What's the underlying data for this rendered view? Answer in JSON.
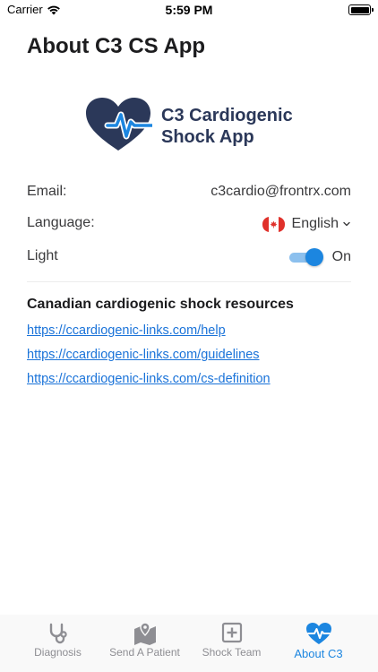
{
  "status_bar": {
    "carrier": "Carrier",
    "time": "5:59 PM",
    "icons": [
      "wifi-icon",
      "battery-icon"
    ]
  },
  "page": {
    "title": "About C3 CS App"
  },
  "logo": {
    "line1": "C3 Cardiogenic",
    "line2": "Shock App",
    "colors": {
      "heart": "#2b3859",
      "pulse": "#1c86e0"
    }
  },
  "settings": {
    "email": {
      "label": "Email:",
      "value": "c3cardio@frontrx.com"
    },
    "language": {
      "label": "Language:",
      "value": "English",
      "flag": "canada-flag-icon"
    },
    "light": {
      "label": "Light",
      "state": "On",
      "enabled": true
    }
  },
  "resources": {
    "heading": "Canadian cardiogenic shock resources",
    "links": [
      "https://ccardiogenic-links.com/help",
      "https://ccardiogenic-links.com/guidelines",
      "https://ccardiogenic-links.com/cs-definition"
    ]
  },
  "tab_bar": {
    "tabs": [
      {
        "label": "Diagnosis",
        "icon": "stethoscope-icon",
        "active": false
      },
      {
        "label": "Send A Patient",
        "icon": "map-pin-icon",
        "active": false
      },
      {
        "label": "Shock Team",
        "icon": "plus-square-icon",
        "active": false
      },
      {
        "label": "About C3",
        "icon": "heart-pulse-icon",
        "active": true
      }
    ]
  },
  "colors": {
    "accent": "#1c86e0",
    "link": "#1a73d9",
    "inactive": "#8e8e93"
  }
}
